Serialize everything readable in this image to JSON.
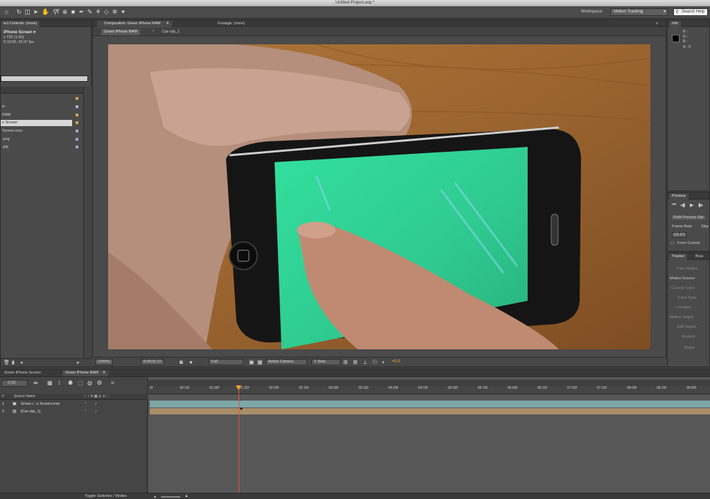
{
  "window": {
    "title": "Untitled Project.aep *"
  },
  "toolbar": {
    "tools": [
      {
        "name": "home-icon",
        "glyph": "⌂"
      },
      {
        "name": "selection-tool-icon",
        "glyph": "➤"
      },
      {
        "name": "hand-tool-icon",
        "glyph": "✋"
      },
      {
        "name": "zoom-tool-icon",
        "glyph": "⚲"
      },
      {
        "name": "rotate-tool-icon",
        "glyph": "↻"
      },
      {
        "name": "camera-tool-icon",
        "glyph": "◫"
      },
      {
        "name": "pan-behind-tool-icon",
        "glyph": "⊕"
      },
      {
        "name": "rectangle-tool-icon",
        "glyph": "■"
      },
      {
        "name": "pen-tool-icon",
        "glyph": "✒"
      },
      {
        "name": "type-tool-icon",
        "glyph": "T"
      },
      {
        "name": "brush-tool-icon",
        "glyph": "✎"
      },
      {
        "name": "clone-stamp-tool-icon",
        "glyph": "⚘"
      },
      {
        "name": "eraser-tool-icon",
        "glyph": "◇"
      },
      {
        "name": "roto-brush-tool-icon",
        "glyph": "✲"
      },
      {
        "name": "puppet-tool-icon",
        "glyph": "✦"
      }
    ],
    "workspace_label": "Workspace:",
    "workspace_value": "Motion Tracking",
    "search_help": "Search Help"
  },
  "project_panel": {
    "tab_label": "ect Controls: (none)",
    "item_name": "iPhone Screen ▾",
    "item_info1": "x 720 (1.00)",
    "item_info2": "0;10;00, 29.97 fps",
    "items": [
      {
        "label": "in",
        "color": "#a9b4d8"
      },
      {
        "label": "RAW",
        "color": "#d6a15a"
      },
      {
        "label": "e Screen",
        "color": "#d6a15a",
        "selected": true
      },
      {
        "label": "Screen.mov",
        "color": "#9aa9d6"
      },
      {
        "label": ".png",
        "color": "#9aa9d6"
      },
      {
        "label": ".jpg",
        "color": "#9aa9d6"
      }
    ]
  },
  "comp_panel": {
    "tab_label": "Composition: Green iPhone RAW",
    "footage_tab": "Footage: (none)",
    "subtabs": [
      "Green iPhone RAW",
      "Car-clip_1"
    ],
    "zoom": "(100%)",
    "timecode": "0;00;01;11",
    "resolution": "Full",
    "camera": "Active Camera",
    "view": "1 View",
    "exposure": "+0.0"
  },
  "info_panel": {
    "tab_label": "Info",
    "r": "R :",
    "g": "G :",
    "b": "B :",
    "a": "A : 0"
  },
  "preview_panel": {
    "tab_label": "Preview",
    "options_label": "RAM Preview Opt",
    "frame_rate_label": "Frame Rate",
    "skip_label": "Skip",
    "frame_rate_value": "(29.97)",
    "from_current": "From Current"
  },
  "tracker_panel": {
    "tab_label": "Tracker",
    "tab2": "Brus",
    "track_motion": "Track Motion",
    "motion_source_label": "Motion Source:",
    "current_track": "Current Track:",
    "track_type": "Track Type:",
    "position": "✓ Position",
    "motion_target": "Motion Target:",
    "edit_target": "Edit Target...",
    "analyze": "Analyze:",
    "reset": "Reset"
  },
  "timeline": {
    "tabs": [
      "Green iPhone Screen",
      "Green iPhone RAW"
    ],
    "timecode": "0;00",
    "column_header": "Source Name",
    "col_hash": "#",
    "layers": [
      {
        "num": "1",
        "name": "Green i...e Screen.mov"
      },
      {
        "num": "2",
        "name": "[Car-clip_1]"
      }
    ],
    "ruler": [
      "0f",
      "00:15f",
      "01:00f",
      "01:15f",
      "02:00f",
      "02:15f",
      "03:00f",
      "03:15f",
      "04:00f",
      "04:15f",
      "05:00f",
      "05:15f",
      "06:00f",
      "06:15f",
      "07:00f",
      "07:15f",
      "08:00f",
      "08:15f",
      "09:00f"
    ],
    "toggle_label": "Toggle Switches / Modes"
  },
  "colors": {
    "layer1_bar": "#7fa6a6",
    "layer2_bar": "#a88f6a",
    "playhead": "#e05a3a",
    "screen_green": "#2fd996"
  }
}
